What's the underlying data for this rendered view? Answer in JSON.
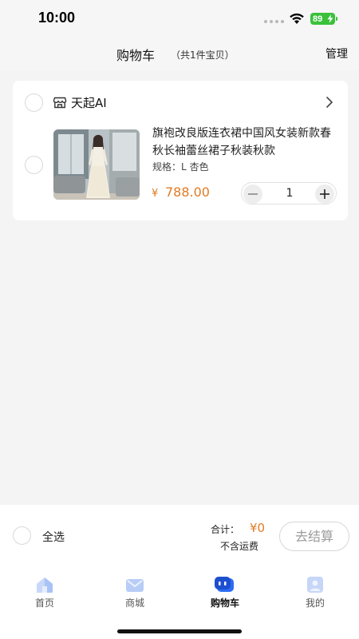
{
  "status_bar": {
    "time": "10:00",
    "battery": "89"
  },
  "nav": {
    "title": "购物车",
    "subtitle": "（共1件宝贝）",
    "manage": "管理"
  },
  "shop": {
    "name": "天起AI",
    "icon": "store-icon",
    "item": {
      "title": "旗袍改良版连衣裙中国风女装新款春秋长袖蕾丝裙子秋装秋款",
      "spec": "规格：L 杏色",
      "price_symbol": "¥",
      "price": "788.00",
      "quantity": "1"
    }
  },
  "footer": {
    "select_all": "全选",
    "total_label": "合计：",
    "total_value": "¥0",
    "shipping_note": "不含运费",
    "checkout": "去结算"
  },
  "tabs": [
    {
      "label": "首页",
      "icon": "home-icon",
      "active": false
    },
    {
      "label": "商城",
      "icon": "mall-icon",
      "active": false
    },
    {
      "label": "购物车",
      "icon": "cart-icon",
      "active": true
    },
    {
      "label": "我的",
      "icon": "profile-icon",
      "active": false
    }
  ],
  "colors": {
    "accent_price": "#e07b24",
    "battery": "#3ac13a",
    "active_tab_icon": "#2b6cf5",
    "inactive_tab_icon": "#a9c3f5"
  }
}
